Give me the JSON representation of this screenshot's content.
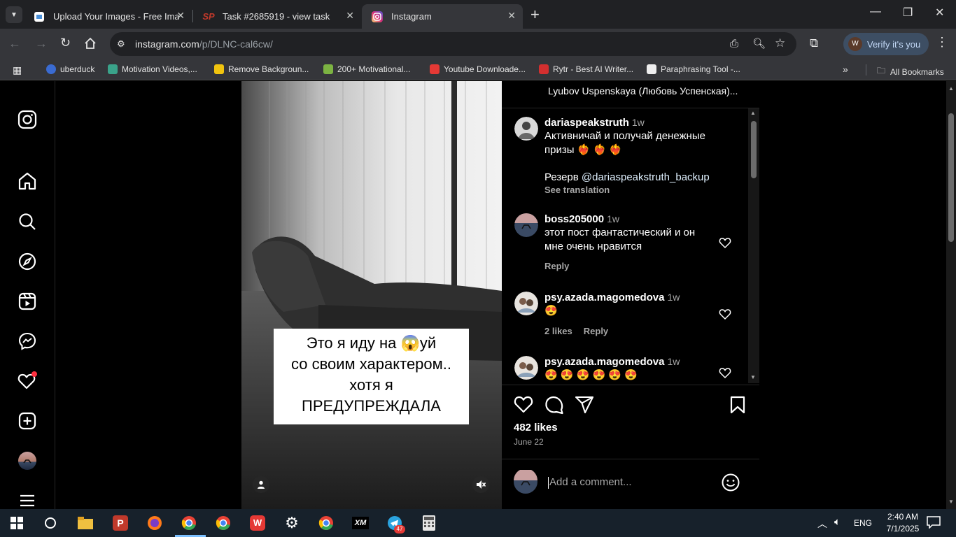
{
  "browser": {
    "tabs": [
      {
        "title": "Upload Your Images - Free Ima",
        "active": false
      },
      {
        "title": "Task #2685919 - view task",
        "active": false
      },
      {
        "title": "Instagram",
        "active": true
      }
    ],
    "url_host": "instagram.com",
    "url_path": "/p/DLNC-cal6cw/",
    "profile_label": "Verify it's you",
    "bookmarks": [
      "uberduck",
      "Motivation Videos,...",
      "Remove Backgroun...",
      "200+ Motivational...",
      "Youtube Downloade...",
      "Rytr - Best AI Writer...",
      "Paraphrasing Tool -..."
    ],
    "all_bookmarks": "All Bookmarks"
  },
  "post": {
    "caption_lines": [
      "Это я иду на 😱уй",
      "со своим характером..",
      "хотя я",
      "ПРЕДУПРЕЖДАЛА"
    ],
    "top_author": "Lyubov Uspenskaya (Любовь Успенская)...",
    "likes": "482 likes",
    "date": "June 22",
    "comment_placeholder": "Add a comment..."
  },
  "comments": [
    {
      "user": "dariaspeakstruth",
      "time": "1w",
      "line1": "Активничай и получай денежные",
      "line2": "призы ❤️‍🔥 ❤️‍🔥 ❤️‍🔥",
      "line3_prefix": "Резерв ",
      "mention": "@dariaspeakstruth_backup",
      "see_translation": "See translation"
    },
    {
      "user": "boss205000",
      "time": "1w",
      "line1": "этот пост фантастический и он",
      "line2": "мне очень нравится",
      "reply": "Reply"
    },
    {
      "user": "psy.azada.magomedova",
      "time": "1w",
      "line1": "😍",
      "likes": "2 likes",
      "reply": "Reply"
    },
    {
      "user": "psy.azada.magomedova",
      "time": "1w",
      "line1": "😍 😍 😍 😍 😍 😍"
    }
  ],
  "taskbar": {
    "lang": "ENG",
    "time": "2:40 AM",
    "date": "7/1/2025",
    "telegram_badge": "47"
  },
  "colors": {
    "accent_blue": "#e0f1ff",
    "mention": "#e0f1ff",
    "notify_red": "#ff3040"
  }
}
